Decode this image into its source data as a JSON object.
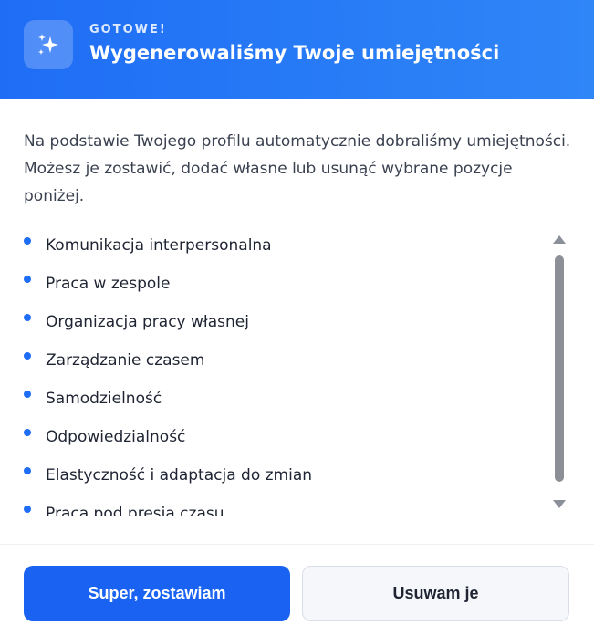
{
  "header": {
    "eyebrow": "GOTOWE!",
    "title": "Wygenerowaliśmy Twoje umiejętności",
    "icon": "sparkles-icon",
    "accent": "#1f6df5"
  },
  "intro": "Na podstawie Twojego profilu automatycznie dobraliśmy umiejętności. Możesz je zostawić, dodać własne lub usunąć wybrane pozycje poniżej.",
  "skills": [
    "Komunikacja interpersonalna",
    "Praca w zespole",
    "Organizacja pracy własnej",
    "Zarządzanie czasem",
    "Samodzielność",
    "Odpowiedzialność",
    "Elastyczność i adaptacja do zmian",
    "Praca pod presją czasu"
  ],
  "actions": {
    "primary": "Super, zostawiam",
    "secondary": "Usuwam je"
  }
}
